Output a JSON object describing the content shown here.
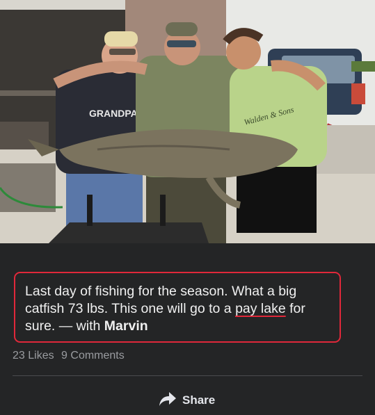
{
  "post": {
    "photo_shirt_text": "GRANDPA",
    "photo_shirt_script": "Walden & Sons",
    "caption_main": "Last day of fishing for the season. What a big catfish 73 lbs. This one will go to a ",
    "caption_underlined": "pay lake",
    "caption_after": " for sure. — with ",
    "caption_tagged": "Marvin"
  },
  "stats": {
    "likes": "23 Likes",
    "comments": "9 Comments"
  },
  "actions": {
    "share_label": "Share"
  },
  "colors": {
    "background": "#242526",
    "highlight": "#e0283a",
    "text": "#f0f0f0"
  }
}
